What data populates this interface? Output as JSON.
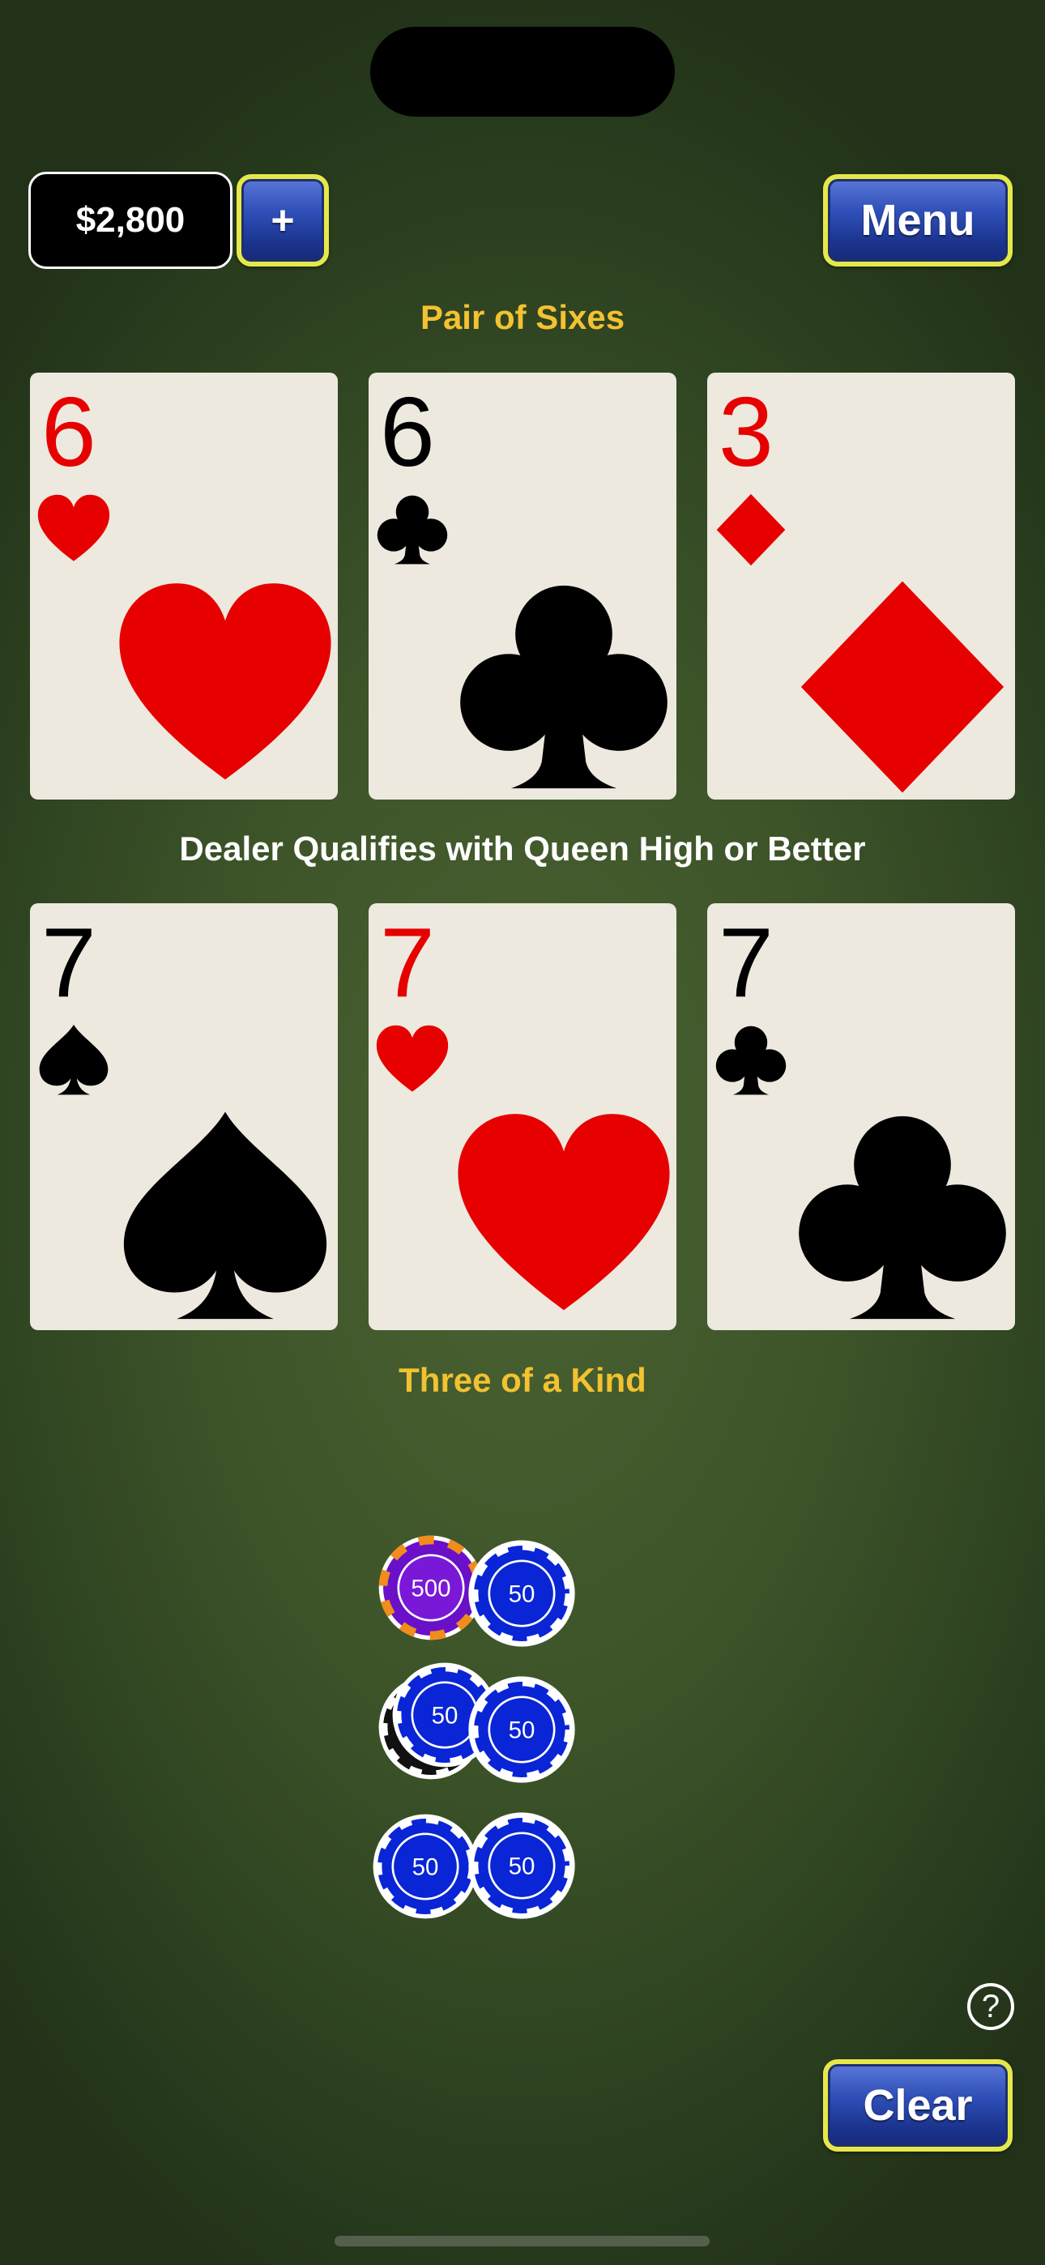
{
  "bankroll": {
    "amount": "$2,800"
  },
  "buttons": {
    "add": "+",
    "menu": "Menu",
    "clear": "Clear",
    "help": "?"
  },
  "dealer": {
    "hand_label": "Pair of Sixes",
    "cards": [
      {
        "rank": "6",
        "suit": "hearts"
      },
      {
        "rank": "6",
        "suit": "clubs"
      },
      {
        "rank": "3",
        "suit": "diamonds"
      }
    ]
  },
  "qualify_text": "Dealer Qualifies with Queen High or Better",
  "player": {
    "hand_label": "Three of a Kind",
    "cards": [
      {
        "rank": "7",
        "suit": "spades"
      },
      {
        "rank": "7",
        "suit": "hearts"
      },
      {
        "rank": "7",
        "suit": "clubs"
      }
    ]
  },
  "bets": {
    "ante": {
      "left_chip": "500",
      "right_chip": "50"
    },
    "play": {
      "left_chip": "50",
      "right_chip": "50"
    },
    "pair_plus": {
      "left_chip": "50",
      "right_chip": "50"
    }
  },
  "colors": {
    "felt": "#3d5429",
    "gold_text": "#f2c230",
    "button_border": "#e6e84a",
    "chip_blue": "#0a25d6",
    "chip_purple": "#6a10c8"
  }
}
